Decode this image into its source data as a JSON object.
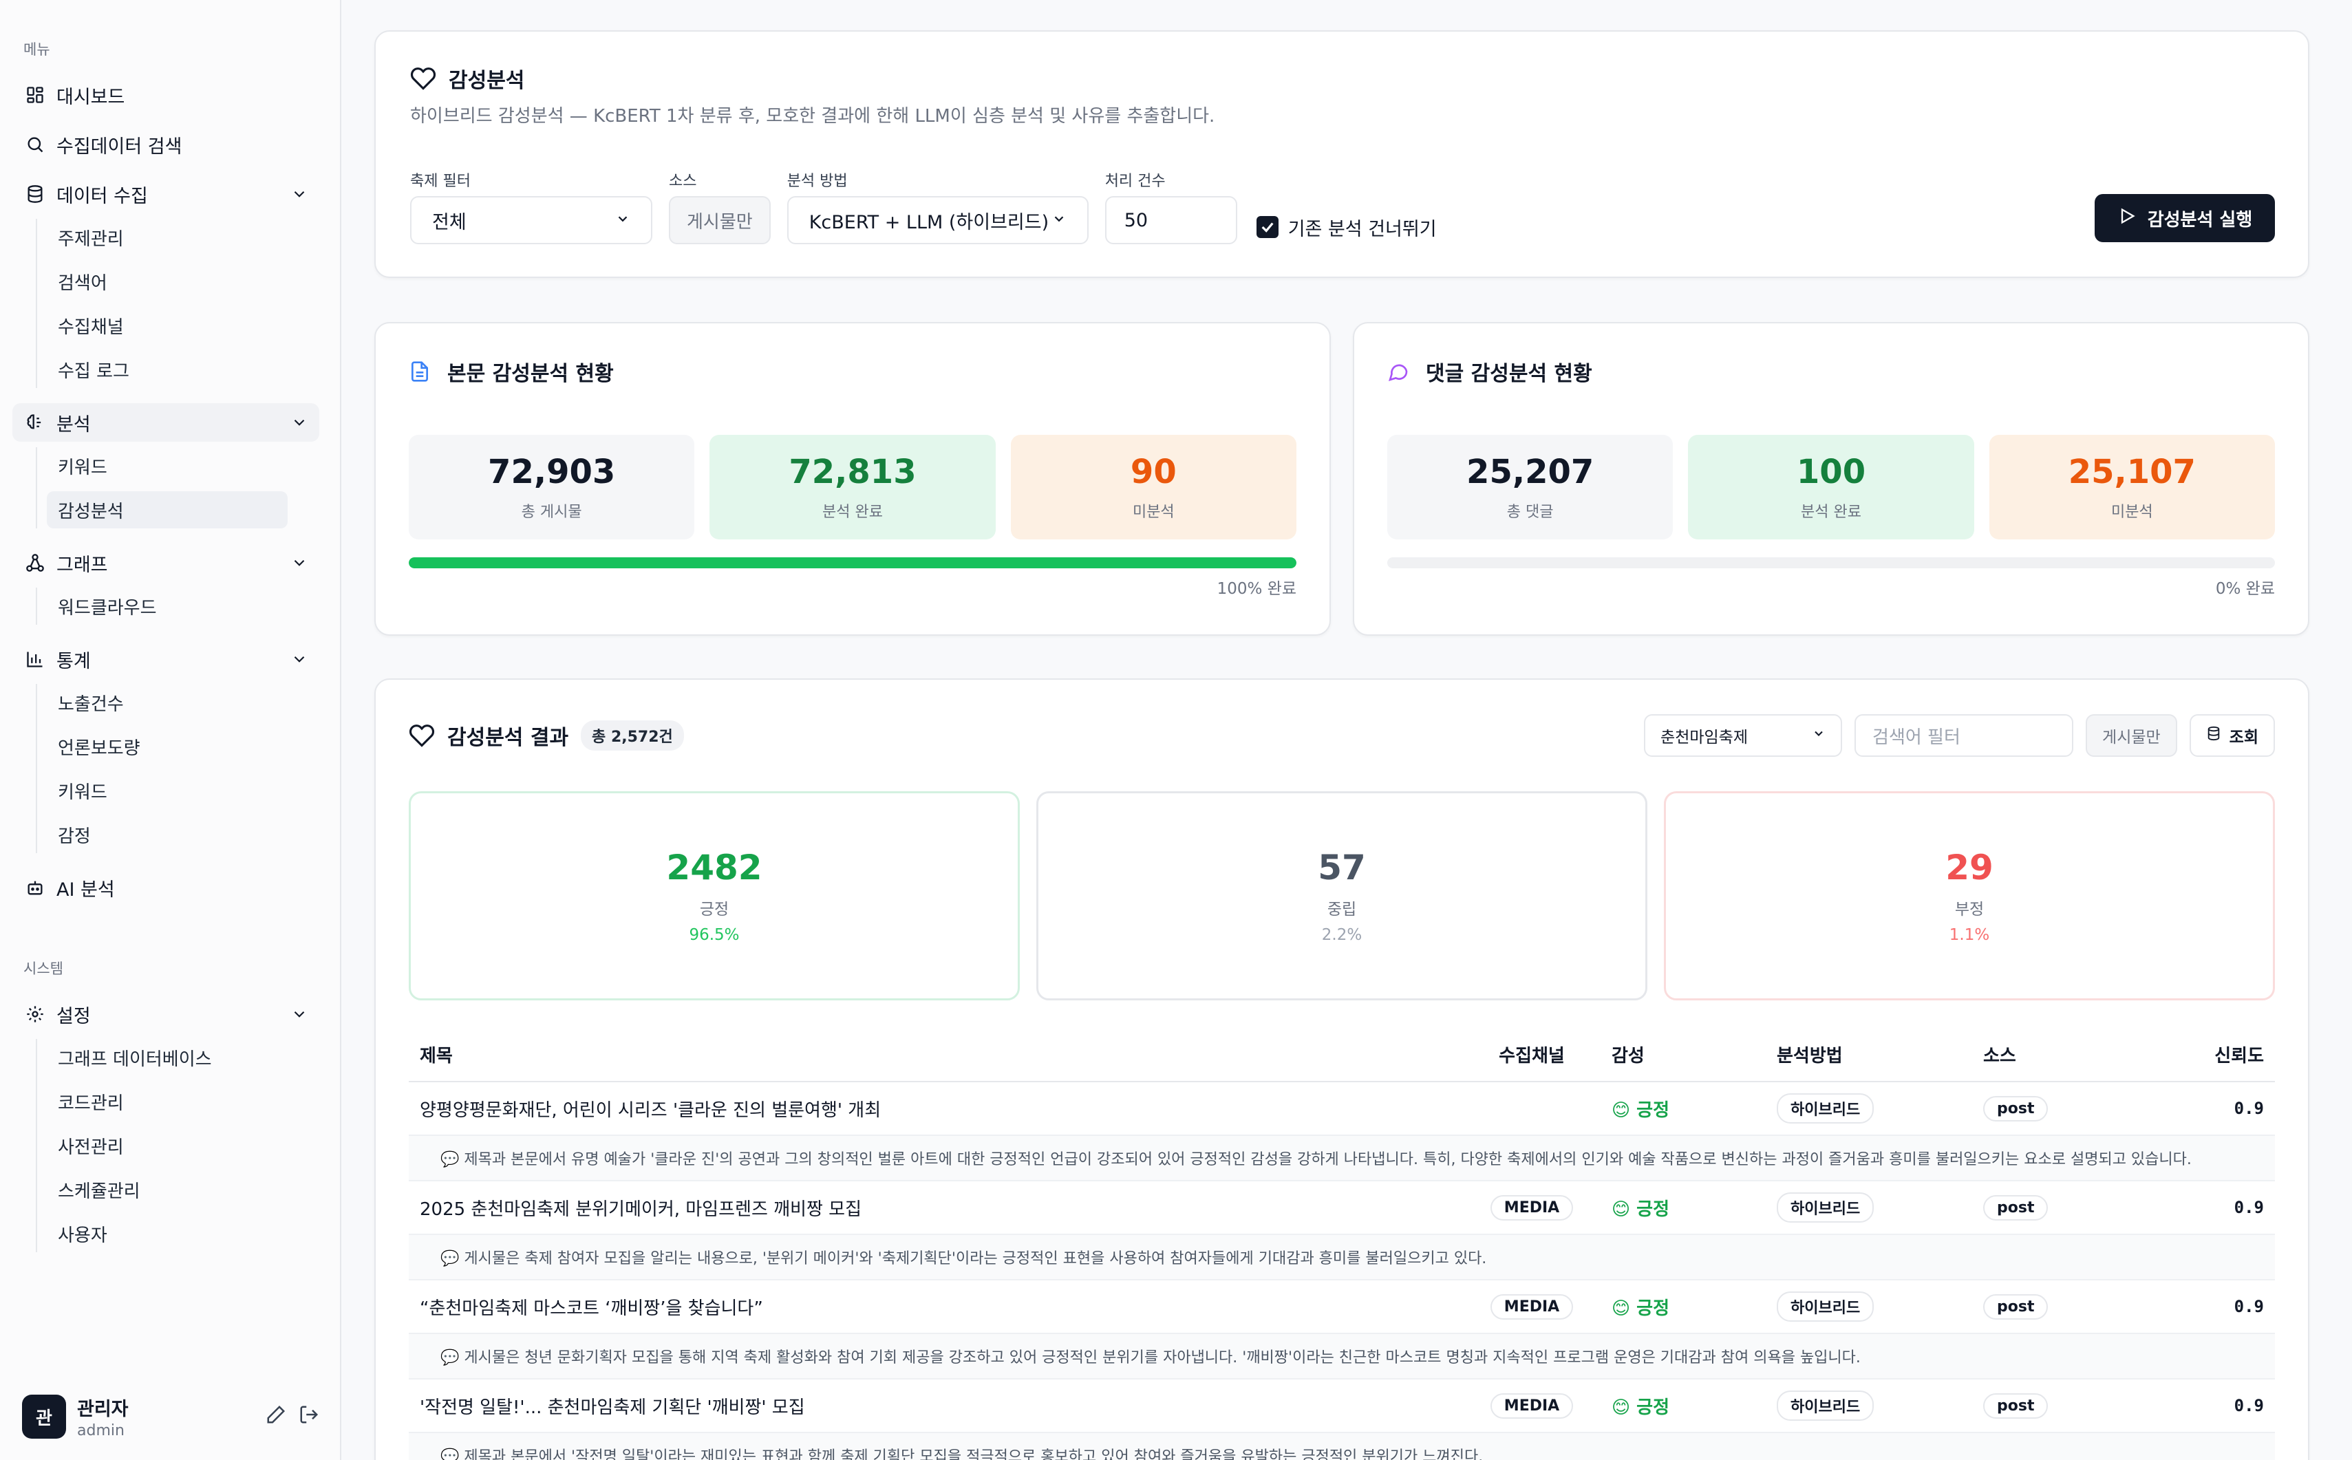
{
  "sidebar": {
    "menu_label": "메뉴",
    "items": {
      "dashboard": "대시보드",
      "search": "수집데이터 검색",
      "collect": "데이터 수집",
      "collect_sub": [
        "주제관리",
        "검색어",
        "수집채널",
        "수집 로그"
      ],
      "analysis": "분석",
      "analysis_sub": [
        "키워드",
        "감성분석"
      ],
      "graph": "그래프",
      "graph_sub": [
        "워드클라우드"
      ],
      "stats": "통계",
      "stats_sub": [
        "노출건수",
        "언론보도량",
        "키워드",
        "감정"
      ],
      "ai": "AI 분석"
    },
    "system_label": "시스템",
    "settings": "설정",
    "settings_sub": [
      "그래프 데이터베이스",
      "코드관리",
      "사전관리",
      "스케쥴관리",
      "사용자"
    ],
    "user": {
      "avatar": "관",
      "name": "관리자",
      "role": "admin"
    }
  },
  "header": {
    "title": "감성분석",
    "subtitle": "하이브리드 감성분석 — KcBERT 1차 분류 후, 모호한 결과에 한해 LLM이 심층 분석 및 사유를 추출합니다."
  },
  "controls": {
    "festival_label": "축제 필터",
    "festival_value": "전체",
    "source_label": "소스",
    "source_button": "게시물만",
    "method_label": "분석 방법",
    "method_value": "KcBERT + LLM (하이브리드)",
    "count_label": "처리 건수",
    "count_value": "50",
    "skip_label": "기존 분석 건너뛰기",
    "run_label": "감성분석 실행"
  },
  "post_stats": {
    "title": "본문 감성분석 현황",
    "total": "72,903",
    "total_label": "총 게시물",
    "done": "72,813",
    "done_label": "분석 완료",
    "pending": "90",
    "pending_label": "미분석",
    "progress": 100,
    "progress_text": "100% 완료"
  },
  "comment_stats": {
    "title": "댓글 감성분석 현황",
    "total": "25,207",
    "total_label": "총 댓글",
    "done": "100",
    "done_label": "분석 완료",
    "pending": "25,107",
    "pending_label": "미분석",
    "progress": 0,
    "progress_text": "0% 완료"
  },
  "results": {
    "title": "감성분석 결과",
    "count_badge": "총 2,572건",
    "festival_select": "춘천마임축제",
    "keyword_placeholder": "검색어 필터",
    "posts_only": "게시물만",
    "query_button": "조회",
    "positive": {
      "count": "2482",
      "label": "긍정",
      "pct": "96.5%"
    },
    "neutral": {
      "count": "57",
      "label": "중립",
      "pct": "2.2%"
    },
    "negative": {
      "count": "29",
      "label": "부정",
      "pct": "1.1%"
    },
    "columns": [
      "제목",
      "수집채널",
      "감성",
      "분석방법",
      "소스",
      "신뢰도"
    ],
    "rows": [
      {
        "title": "양평양평문화재단, 어린이 시리즈 '클라운 진의 벌룬여행' 개최",
        "channel": "",
        "sentiment": "😊 긍정",
        "method": "하이브리드",
        "source": "post",
        "confidence": "0.9",
        "reason": "💬 제목과 본문에서 유명 예술가 '클라운 진'의 공연과 그의 창의적인 벌룬 아트에 대한 긍정적인 언급이 강조되어 있어 긍정적인 감성을 강하게 나타냅니다. 특히, 다양한 축제에서의 인기와 예술 작품으로 변신하는 과정이 즐거움과 흥미를 불러일으키는 요소로 설명되고 있습니다."
      },
      {
        "title": "2025 춘천마임축제 분위기메이커, 마임프렌즈 깨비짱 모집",
        "channel": "MEDIA",
        "sentiment": "😊 긍정",
        "method": "하이브리드",
        "source": "post",
        "confidence": "0.9",
        "reason": "💬 게시물은 축제 참여자 모집을 알리는 내용으로, '분위기 메이커'와 '축제기획단'이라는 긍정적인 표현을 사용하여 참여자들에게 기대감과 흥미를 불러일으키고 있다."
      },
      {
        "title": "“춘천마임축제 마스코트 ‘깨비짱’을 찾습니다”",
        "channel": "MEDIA",
        "sentiment": "😊 긍정",
        "method": "하이브리드",
        "source": "post",
        "confidence": "0.9",
        "reason": "💬 게시물은 청년 문화기획자 모집을 통해 지역 축제 활성화와 참여 기회 제공을 강조하고 있어 긍정적인 분위기를 자아냅니다. '깨비짱'이라는 친근한 마스코트 명칭과 지속적인 프로그램 운영은 기대감과 참여 의욕을 높입니다."
      },
      {
        "title": "'작전명 일탈!'... 춘천마임축제 기획단 '깨비짱' 모집",
        "channel": "MEDIA",
        "sentiment": "😊 긍정",
        "method": "하이브리드",
        "source": "post",
        "confidence": "0.9",
        "reason": "💬 제목과 본문에서 '작전명 일탈'이라는 재미있는 표현과 함께 축제 기획단 모집을 적극적으로 홍보하고 있어 참여와 즐거움을 유발하는 긍정적인 분위기가 느껴진다."
      }
    ]
  }
}
